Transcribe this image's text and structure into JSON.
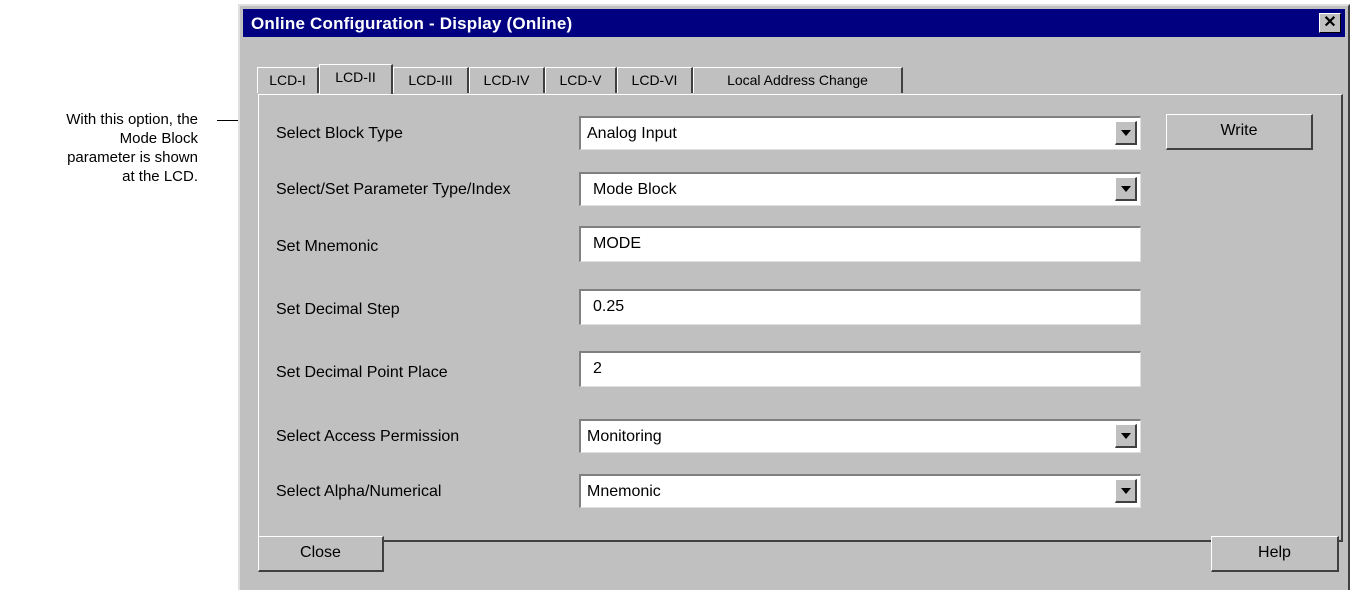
{
  "annotation": {
    "lines": [
      "With this option, the",
      "Mode Block",
      "parameter is shown",
      "at the LCD."
    ]
  },
  "window": {
    "title": "Online Configuration - Display  (Online)",
    "close_glyph": "✕"
  },
  "tabs": [
    {
      "label": "LCD-I",
      "active": false
    },
    {
      "label": "LCD-II",
      "active": true
    },
    {
      "label": "LCD-III",
      "active": false
    },
    {
      "label": "LCD-IV",
      "active": false
    },
    {
      "label": "LCD-V",
      "active": false
    },
    {
      "label": "LCD-VI",
      "active": false
    },
    {
      "label": "Local Address Change",
      "active": false
    }
  ],
  "form": {
    "block_type": {
      "label": "Select Block Type",
      "value": "Analog Input"
    },
    "param_type": {
      "label": "Select/Set Parameter Type/Index",
      "value": "Mode Block"
    },
    "mnemonic": {
      "label": "Set Mnemonic",
      "value": "MODE"
    },
    "decimal_step": {
      "label": "Set Decimal Step",
      "value": "0.25"
    },
    "decimal_point": {
      "label": "Set Decimal Point Place",
      "value": "2"
    },
    "access": {
      "label": "Select Access Permission",
      "value": "Monitoring"
    },
    "alpha_num": {
      "label": "Select Alpha/Numerical",
      "value": "Mnemonic"
    }
  },
  "buttons": {
    "write": "Write",
    "close": "Close",
    "help": "Help"
  },
  "colors": {
    "titlebar": "#000080",
    "face": "#c0c0c0"
  }
}
